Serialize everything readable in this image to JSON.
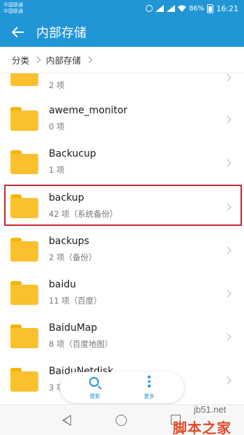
{
  "status_bar": {
    "carrier1": "中国联通",
    "carrier2": "中国联通",
    "battery": "86%",
    "time": "16:21"
  },
  "header": {
    "title": "内部存储"
  },
  "breadcrumb": [
    "分类",
    "内部存储"
  ],
  "folders": [
    {
      "name": "",
      "meta": "2 项"
    },
    {
      "name": "aweme_monitor",
      "meta": "0 项"
    },
    {
      "name": "Backucup",
      "meta": "1 项"
    },
    {
      "name": "backup",
      "meta": "42 项（系统备份）"
    },
    {
      "name": "backups",
      "meta": "2 项（备份）"
    },
    {
      "name": "baidu",
      "meta": "11 项（百度）"
    },
    {
      "name": "BaiduMap",
      "meta": "8 项（百度地图）"
    },
    {
      "name": "BaiduNetdisk",
      "meta": "3 项"
    }
  ],
  "floating_actions": {
    "search": "搜索",
    "more": "更多"
  },
  "watermark": {
    "site": "jb51.net",
    "text": "脚本之家"
  },
  "colors": {
    "accent": "#2196d6",
    "folder": "#fbc02d",
    "highlight": "#c0272d"
  }
}
